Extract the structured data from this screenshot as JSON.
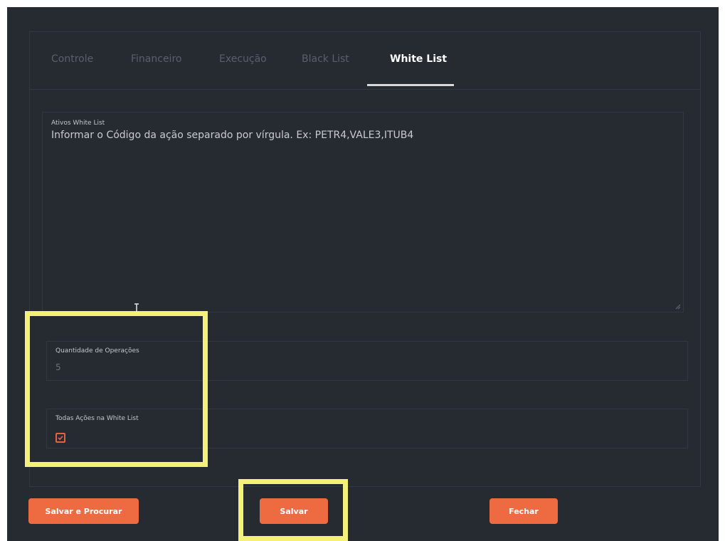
{
  "tabs": [
    {
      "label": "Controle",
      "active": false
    },
    {
      "label": "Financeiro",
      "active": false
    },
    {
      "label": "Execução",
      "active": false
    },
    {
      "label": "Black List",
      "active": false
    },
    {
      "label": "White List",
      "active": true
    }
  ],
  "white_list": {
    "label": "Ativos White List",
    "placeholder": "Informar o Código da ação separado por vírgula. Ex: PETR4,VALE3,ITUB4",
    "value": ""
  },
  "quantidade": {
    "label": "Quantidade de Operações",
    "value": "5"
  },
  "todas_acoes": {
    "label": "Todas Ações na White List",
    "checked": true
  },
  "buttons": {
    "salvar_procurar": "Salvar e Procurar",
    "salvar": "Salvar",
    "fechar": "Fechar"
  },
  "colors": {
    "background": "#262b31",
    "accent": "#ee6a41",
    "highlight": "#f5f07a"
  }
}
